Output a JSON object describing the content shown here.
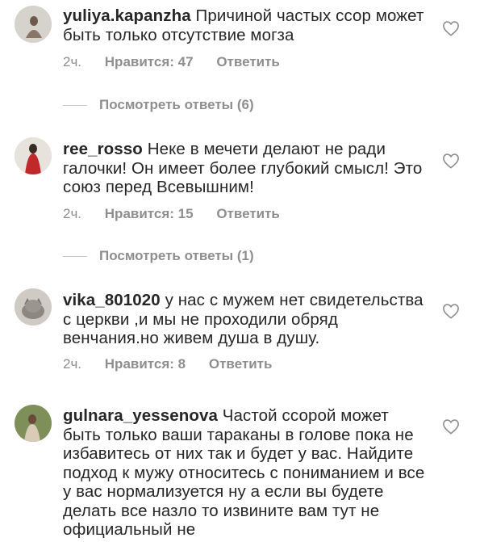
{
  "comments": [
    {
      "username": "yuliya.kapanzha",
      "text": "Причиной частых ссор может быть только отсутствие могза",
      "time": "2ч.",
      "likes": "Нравится: 47",
      "reply": "Ответить",
      "view_replies": "Посмотреть ответы (6)"
    },
    {
      "username": "ree_rosso",
      "text": "Неке в мечети делают не ради галочки! Он имеет более глубокий смысл! Это союз перед Всевышним!",
      "time": "2ч.",
      "likes": "Нравится: 15",
      "reply": "Ответить",
      "view_replies": "Посмотреть ответы (1)"
    },
    {
      "username": "vika_801020",
      "text": "у нас с мужем нет свидетельства с церкви ,и мы не проходили обряд венчания.но живем душа в душу.",
      "time": "2ч.",
      "likes": "Нравится: 8",
      "reply": "Ответить"
    },
    {
      "username": "gulnara_yessenova",
      "text": "Частой ссорой может быть только ваши тараканы в голове пока не избавитесь от них так и будет у вас. Найдите подход к мужу относитесь с пониманием и все у вас нормализуется ну а если вы будете делать все назло то извините вам тут не официальный не"
    }
  ],
  "icons": {
    "like": "heart-outline-icon"
  },
  "colors": {
    "text": "#262626",
    "secondary": "#8e8e8e",
    "background": "#ffffff"
  }
}
